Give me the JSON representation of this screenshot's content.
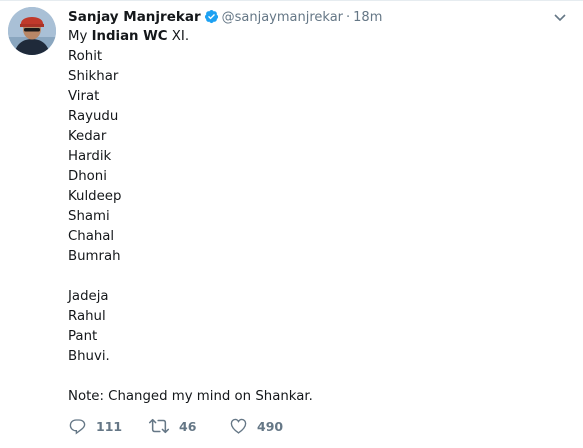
{
  "tweet": {
    "author_name": "Sanjay Manjrekar",
    "handle": "@sanjaymanjrekar",
    "separator": "·",
    "time": "18m",
    "intro_prefix": "My ",
    "intro_bold": "Indian WC",
    "intro_suffix": " XI.",
    "playing_xi": [
      "Rohit",
      "Shikhar",
      "Virat",
      "Rayudu",
      "Kedar",
      "Hardik",
      "Dhoni",
      "Kuldeep",
      "Shami",
      "Chahal",
      "Bumrah"
    ],
    "reserves": [
      "Jadeja",
      "Rahul",
      "Pant",
      "Bhuvi."
    ],
    "note": "Note: Changed my mind on Shankar."
  },
  "actions": {
    "reply_count": "111",
    "retweet_count": "46",
    "like_count": "490"
  },
  "colors": {
    "text": "#14171a",
    "secondary": "#657786",
    "verified": "#1da1f2",
    "border": "#e6ecf0"
  },
  "icons": [
    "avatar",
    "verified-badge-icon",
    "chevron-down-icon",
    "reply-icon",
    "retweet-icon",
    "like-icon"
  ]
}
